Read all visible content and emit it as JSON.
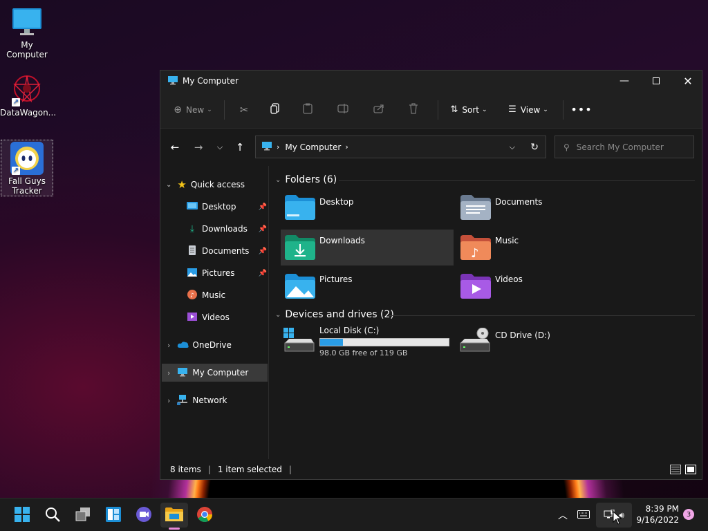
{
  "desktop": {
    "icons": [
      {
        "label": "My Computer"
      },
      {
        "label": "DataWagon..."
      },
      {
        "label": "Fall Guys Tracker"
      }
    ]
  },
  "window": {
    "title": "My Computer",
    "toolbar": {
      "new_label": "New",
      "sort_label": "Sort",
      "view_label": "View"
    },
    "address": {
      "crumb": "My Computer"
    },
    "search": {
      "placeholder": "Search My Computer"
    },
    "sidebar": {
      "quick_access": "Quick access",
      "items": [
        {
          "label": "Desktop",
          "pinned": true
        },
        {
          "label": "Downloads",
          "pinned": true
        },
        {
          "label": "Documents",
          "pinned": true
        },
        {
          "label": "Pictures",
          "pinned": true
        },
        {
          "label": "Music",
          "pinned": false
        },
        {
          "label": "Videos",
          "pinned": false
        }
      ],
      "onedrive": "OneDrive",
      "my_computer": "My Computer",
      "network": "Network"
    },
    "folders": {
      "header": "Folders (6)",
      "items": [
        {
          "label": "Desktop",
          "icon": "folder-desktop-icon",
          "color": "#2a9de6"
        },
        {
          "label": "Documents",
          "icon": "folder-documents-icon",
          "color": "#8a9bb0"
        },
        {
          "label": "Downloads",
          "icon": "folder-downloads-icon",
          "color": "#1fb38a"
        },
        {
          "label": "Music",
          "icon": "folder-music-icon",
          "color": "#e8704a"
        },
        {
          "label": "Pictures",
          "icon": "folder-pictures-icon",
          "color": "#2a9de6"
        },
        {
          "label": "Videos",
          "icon": "folder-videos-icon",
          "color": "#9b4fd6"
        }
      ]
    },
    "drives": {
      "header": "Devices and drives (2)",
      "local": {
        "label": "Local Disk (C:)",
        "free": "98.0 GB free of 119 GB",
        "used_fraction": 0.18
      },
      "cd": {
        "label": "CD Drive (D:)"
      }
    },
    "status": {
      "items": "8 items",
      "selected": "1 item selected"
    }
  },
  "taskbar": {
    "time": "8:39 PM",
    "date": "9/16/2022",
    "notifications": "3"
  }
}
